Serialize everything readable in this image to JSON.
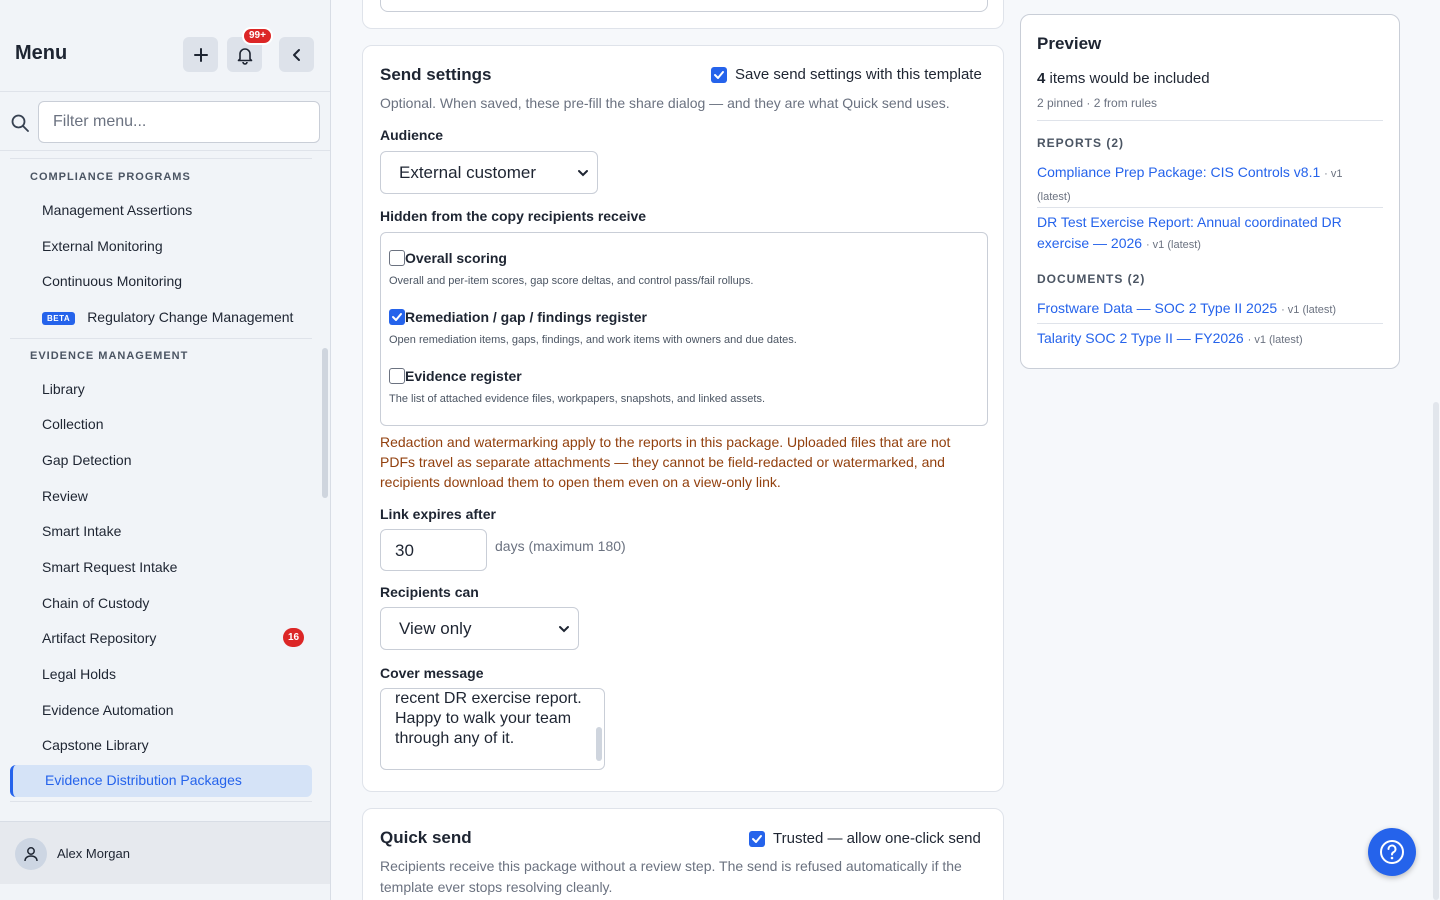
{
  "sidebar": {
    "title": "Menu",
    "notif_badge": "99+",
    "filter_placeholder": "Filter menu...",
    "sections": [
      {
        "label": "COMPLIANCE PROGRAMS",
        "items": [
          "Management Assertions",
          "External Monitoring",
          "Continuous Monitoring",
          "Regulatory Change Management"
        ]
      },
      {
        "label": "EVIDENCE MANAGEMENT",
        "items": [
          "Library",
          "Collection",
          "Gap Detection",
          "Review",
          "Smart Intake",
          "Smart Request Intake",
          "Chain of Custody",
          "Artifact Repository",
          "Legal Holds",
          "Evidence Automation",
          "Capstone Library",
          "Evidence Distribution Packages"
        ]
      }
    ],
    "beta_label": "BETA",
    "artifact_count": "16",
    "user": "Alex Morgan"
  },
  "send_settings": {
    "title": "Send settings",
    "save_label": "Save send settings with this template",
    "description": "Optional. When saved, these pre-fill the share dialog — and they are what Quick send uses.",
    "audience_label": "Audience",
    "audience_value": "External customer",
    "hidden_label": "Hidden from the copy recipients receive",
    "hidden_options": [
      {
        "title": "Overall scoring",
        "desc": "Overall and per-item scores, gap score deltas, and control pass/fail rollups.",
        "checked": false
      },
      {
        "title": "Remediation / gap / findings register",
        "desc": "Open remediation items, gaps, findings, and work items with owners and due dates.",
        "checked": true
      },
      {
        "title": "Evidence register",
        "desc": "The list of attached evidence files, workpapers, snapshots, and linked assets.",
        "checked": false
      }
    ],
    "warning": "Redaction and watermarking apply to the reports in this package. Uploaded files that are not PDFs travel as separate attachments — they cannot be field-redacted or watermarked, and recipients download them to open them even on a view-only link.",
    "expires_label": "Link expires after",
    "expires_value": "30",
    "expires_hint": "days (maximum 180)",
    "recipients_label": "Recipients can",
    "recipients_value": "View only",
    "cover_label": "Cover message",
    "cover_text": "recent DR exercise report. Happy to walk your team through any of it."
  },
  "quick_send": {
    "title": "Quick send",
    "trusted_label": "Trusted — allow one-click send",
    "description": "Recipients receive this package without a review step. The send is refused automatically if the template ever stops resolving cleanly."
  },
  "preview": {
    "title": "Preview",
    "count": "4",
    "count_text": "items would be included",
    "sub": "2 pinned · 2 from rules",
    "reports_label": "REPORTS (2)",
    "reports": [
      {
        "name": "Compliance Prep Package: CIS Controls v8.1",
        "ver": "· v1 (latest)"
      },
      {
        "name": "DR Test Exercise Report: Annual coordinated DR exercise — 2026",
        "ver": "· v1 (latest)"
      }
    ],
    "documents_label": "DOCUMENTS (2)",
    "documents": [
      {
        "name": "Frostware Data — SOC 2 Type II 2025",
        "ver": "· v1 (latest)"
      },
      {
        "name": "Talarity SOC 2 Type II — FY2026",
        "ver": "· v1 (latest)"
      }
    ]
  },
  "colors": {
    "accent": "#2563eb",
    "danger": "#dc2626",
    "warning_text": "#92400e"
  },
  "icons": [
    "plus-icon",
    "bell-icon",
    "chevron-left-icon",
    "search-icon",
    "user-icon",
    "chevron-down-icon",
    "check-icon",
    "help-icon"
  ]
}
